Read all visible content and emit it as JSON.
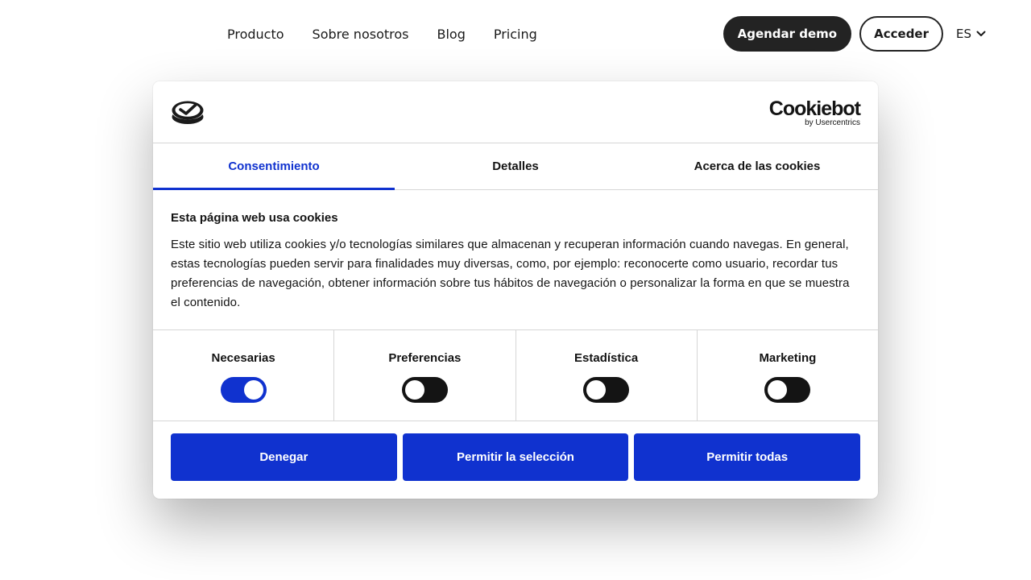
{
  "nav": {
    "links": [
      "Producto",
      "Sobre nosotros",
      "Blog",
      "Pricing"
    ],
    "demo_label": "Agendar demo",
    "login_label": "Acceder",
    "language": "ES"
  },
  "dialog": {
    "brand_logo_icon": "checkmark-stack-logo-icon",
    "cookiebot": {
      "name": "Cookiebot",
      "by": "by Usercentrics"
    },
    "tabs": [
      "Consentimiento",
      "Detalles",
      "Acerca de las cookies"
    ],
    "active_tab": "Consentimiento",
    "title": "Esta página web usa cookies",
    "body": "Este sitio web utiliza cookies y/o tecnologías similares que almacenan y recuperan información cuando navegas. En general, estas tecnologías pueden servir para finalidades muy diversas, como, por ejemplo: reconocerte como usuario, recordar tus preferencias de navegación, obtener información sobre tus hábitos de navegación o personalizar la forma en que se muestra el contenido.",
    "categories": [
      {
        "label": "Necesarias",
        "enabled": true
      },
      {
        "label": "Preferencias",
        "enabled": false
      },
      {
        "label": "Estadística",
        "enabled": false
      },
      {
        "label": "Marketing",
        "enabled": false
      }
    ],
    "buttons": {
      "deny": "Denegar",
      "allow_selection": "Permitir la selección",
      "allow_all": "Permitir todas"
    }
  },
  "colors": {
    "accent": "#1032cf",
    "dark": "#232323",
    "toggle_off": "#141414",
    "divider": "#d6d6d6"
  }
}
